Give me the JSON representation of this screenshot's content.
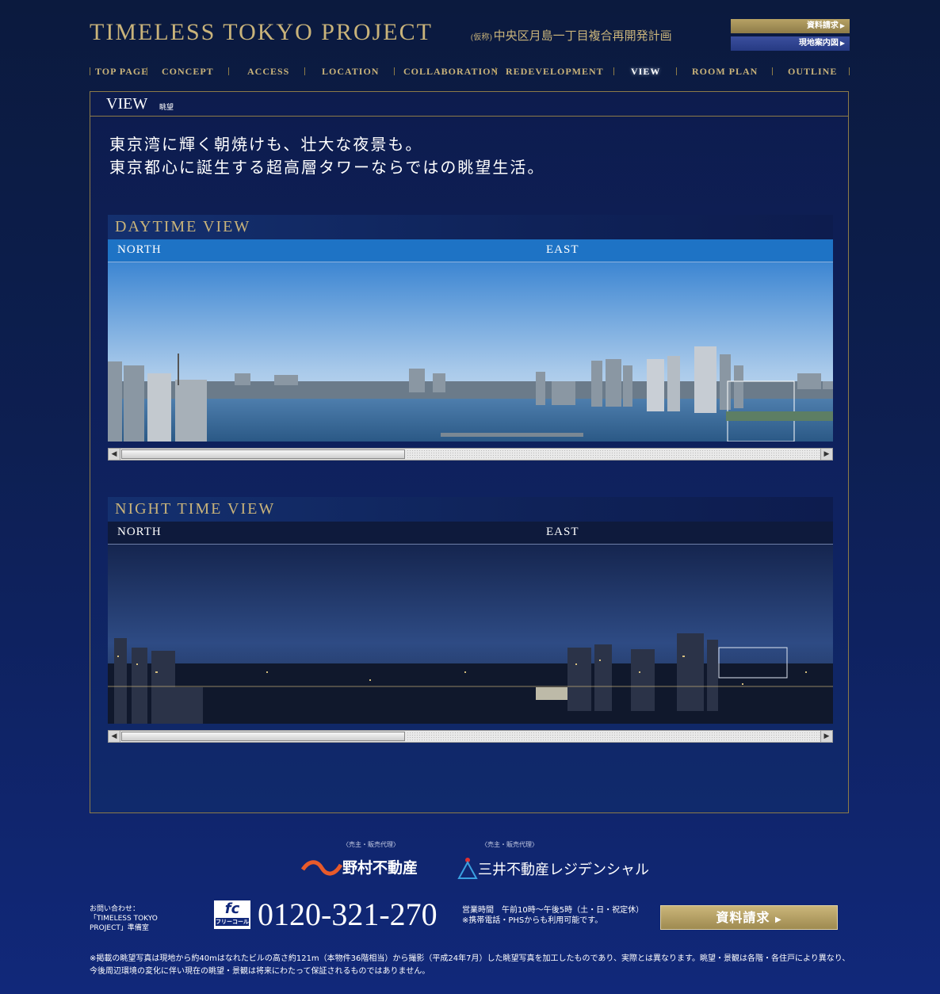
{
  "header": {
    "title": "TIMELESS TOKYO PROJECT",
    "subtitle_prefix": "(仮称)",
    "subtitle": "中央区月島一丁目複合再開発計画",
    "request_button": "資料請求",
    "map_button": "現地案内図"
  },
  "nav": {
    "items": [
      "TOP PAGE",
      "CONCEPT",
      "ACCESS",
      "LOCATION",
      "COLLABORATION",
      "REDEVELOPMENT",
      "VIEW",
      "ROOM PLAN",
      "OUTLINE"
    ],
    "active": "VIEW"
  },
  "main": {
    "title": "VIEW",
    "title_sub": "眺望",
    "lead_line1": "東京湾に輝く朝焼けも、壮大な夜景も。",
    "lead_line2": "東京都心に誕生する超高層タワーならではの眺望生活。"
  },
  "views": {
    "day": {
      "title": "DAYTIME VIEW",
      "dir_left": "NORTH",
      "dir_right": "EAST",
      "scroll_position": 0.4
    },
    "night": {
      "title": "NIGHT TIME VIEW",
      "dir_left": "NORTH",
      "dir_right": "EAST",
      "scroll_position": 0.4
    }
  },
  "footer": {
    "sponsor_caption": "〈売主・販売代理〉",
    "sponsor1": "野村不動産",
    "sponsor2": "三井不動産レジデンシャル",
    "contact_label": "お問い合わせ：「TIMELESS TOKYO PROJECT」準備室",
    "fc_logo": "fc",
    "fc_label": "フリーコール",
    "phone": "0120-321-270",
    "hours": "営業時間　午前10時〜午後5時（土・日・祝定休）",
    "mobile": "※携帯電話・PHSからも利用可能です。",
    "request_button": "資料請求",
    "note": "※掲載の眺望写真は現地から約40mはなれたビルの高さ約121m（本物件36階相当）から撮影（平成24年7月）した眺望写真を加工したものであり、実際とは異なります。眺望・景観は各階・各住戸により異なり、今後周辺環境の変化に伴い現在の眺望・景観は将来にわたって保証されるものではありません。"
  },
  "colors": {
    "gold": "#c9b37a",
    "navy": "#0d1f52",
    "sky_day": "#1e73c5"
  }
}
